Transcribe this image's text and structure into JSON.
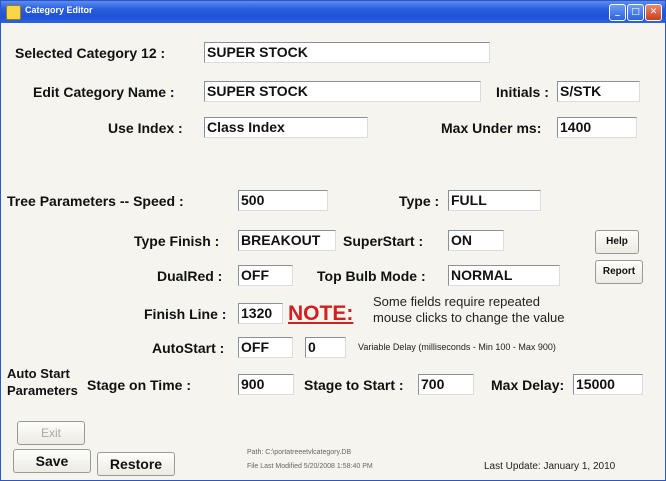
{
  "window": {
    "title": "Category Editor",
    "min_glyph": "_",
    "max_glyph": "□",
    "close_glyph": "✕"
  },
  "selected_category": {
    "label": "Selected Category 12 :",
    "value": "SUPER STOCK"
  },
  "edit_name": {
    "label": "Edit Category Name :",
    "value": "SUPER STOCK"
  },
  "initials": {
    "label": "Initials :",
    "value": "S/STK"
  },
  "use_index": {
    "label": "Use Index :",
    "value": "Class Index"
  },
  "max_under": {
    "label": "Max Under ms:",
    "value": "1400"
  },
  "tree_speed": {
    "label": "Tree Parameters -- Speed :",
    "value": "500"
  },
  "type": {
    "label": "Type :",
    "value": "FULL"
  },
  "type_finish": {
    "label": "Type Finish :",
    "value": "BREAKOUT"
  },
  "superstart": {
    "label": "SuperStart :",
    "value": "ON"
  },
  "help_label": "Help",
  "dualred": {
    "label": "DualRed :",
    "value": "OFF"
  },
  "top_bulb": {
    "label": "Top Bulb Mode :",
    "value": "NORMAL"
  },
  "report_label": "Report",
  "finish_line": {
    "label": "Finish Line :",
    "value": "1320"
  },
  "note": {
    "title": "NOTE:",
    "line1": "Some fields require repeated",
    "line2": "mouse clicks to change the value"
  },
  "autostart": {
    "label": "AutoStart :",
    "value": "OFF",
    "delay_value": "0",
    "delay_text": "Variable Delay  (milliseconds - Min 100 - Max 900)"
  },
  "auto_start_params": {
    "label_line1": "Auto Start",
    "label_line2": "Parameters"
  },
  "stage_on_time": {
    "label": "Stage on Time :",
    "value": "900"
  },
  "stage_to_start": {
    "label": "Stage to Start :",
    "value": "700"
  },
  "max_delay": {
    "label": "Max Delay:",
    "value": "15000"
  },
  "buttons": {
    "exit": "Exit",
    "save": "Save",
    "restore": "Restore"
  },
  "footer": {
    "path": "Path: C:\\portatreeetvlcategory.DB",
    "modified": "File Last Modified 5/20/2008 1:58:40 PM",
    "last_update": "Last Update: January 1, 2010"
  }
}
